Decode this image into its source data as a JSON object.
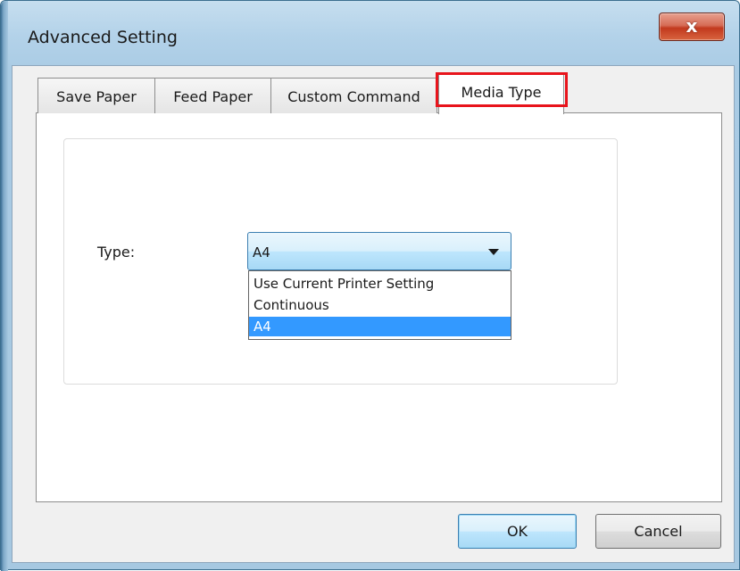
{
  "window": {
    "title": "Advanced Setting",
    "close_glyph": "x"
  },
  "tabs": [
    {
      "label": "Save Paper",
      "active": false
    },
    {
      "label": "Feed Paper",
      "active": false
    },
    {
      "label": "Custom Command",
      "active": false
    },
    {
      "label": "Media Type",
      "active": true
    }
  ],
  "media_type": {
    "type_label": "Type:",
    "selected_value": "A4",
    "options": [
      {
        "label": "Use Current Printer Setting",
        "selected": false
      },
      {
        "label": "Continuous",
        "selected": false
      },
      {
        "label": "A4",
        "selected": true
      }
    ]
  },
  "buttons": {
    "ok_label": "OK",
    "cancel_label": "Cancel"
  },
  "colors": {
    "highlight_box": "#e8141c",
    "selection": "#3399ff",
    "close_button": "#c2391e"
  },
  "icons": {
    "close": "close-icon",
    "dropdown": "chevron-down-icon"
  }
}
